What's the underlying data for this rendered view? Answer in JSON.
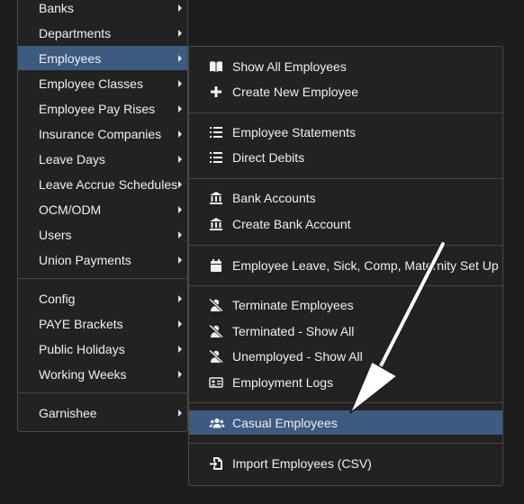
{
  "main_menu": {
    "items": [
      {
        "label": "Banks"
      },
      {
        "label": "Departments"
      },
      {
        "label": "Employees"
      },
      {
        "label": "Employee Classes"
      },
      {
        "label": "Employee Pay Rises"
      },
      {
        "label": "Insurance Companies"
      },
      {
        "label": "Leave Days"
      },
      {
        "label": "Leave Accrue Schedules"
      },
      {
        "label": "OCM/ODM"
      },
      {
        "label": "Users"
      },
      {
        "label": "Union Payments"
      },
      {
        "label": "Config"
      },
      {
        "label": "PAYE Brackets"
      },
      {
        "label": "Public Holidays"
      },
      {
        "label": "Working Weeks"
      },
      {
        "label": "Garnishee"
      }
    ]
  },
  "employees_submenu": {
    "items": [
      {
        "label": "Show All Employees",
        "icon": "book-icon"
      },
      {
        "label": "Create New Employee",
        "icon": "plus-icon"
      },
      {
        "label": "Employee Statements",
        "icon": "list-icon"
      },
      {
        "label": "Direct Debits",
        "icon": "list-icon"
      },
      {
        "label": "Bank Accounts",
        "icon": "bank-icon"
      },
      {
        "label": "Create Bank Account",
        "icon": "bank-icon"
      },
      {
        "label": "Employee Leave, Sick, Comp, Maternity Set Up",
        "icon": "calendar-icon"
      },
      {
        "label": "Terminate Employees",
        "icon": "user-slash-icon"
      },
      {
        "label": "Terminated - Show All",
        "icon": "user-slash-icon"
      },
      {
        "label": "Unemployed - Show All",
        "icon": "user-slash-icon"
      },
      {
        "label": "Employment Logs",
        "icon": "id-card-icon"
      },
      {
        "label": "Casual Employees",
        "icon": "users-icon"
      },
      {
        "label": "Import Employees (CSV)",
        "icon": "file-import-icon"
      }
    ]
  },
  "colors": {
    "active_background": "#3d5a80",
    "menu_background": "#222222",
    "annotation_arrow": "#ffffff"
  }
}
